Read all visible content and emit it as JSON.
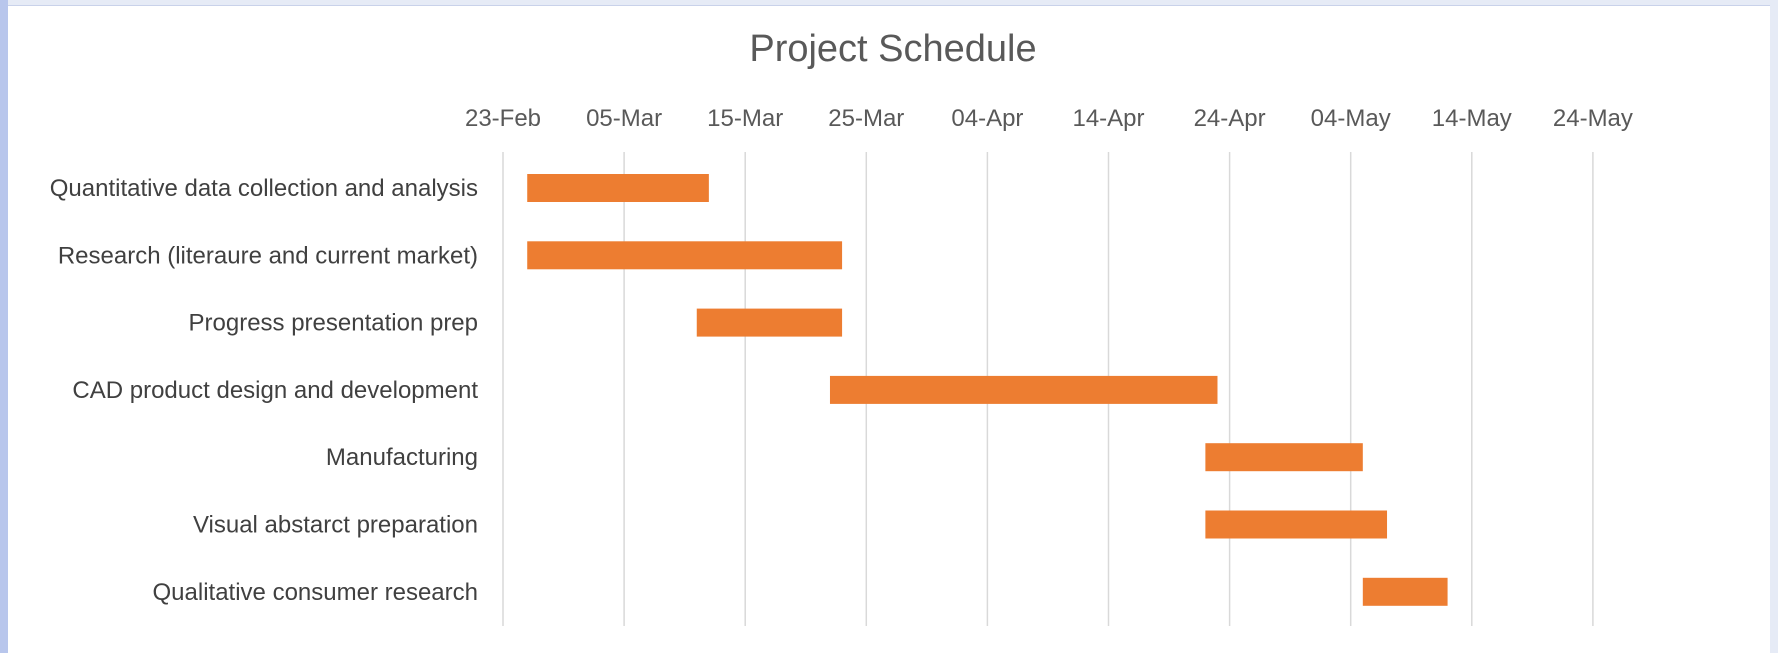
{
  "chart_data": {
    "type": "bar",
    "subtype": "gantt",
    "title": "Project Schedule",
    "bar_color": "#ED7D31",
    "grid": true,
    "x_axis_position": "top",
    "xlim": [
      "2020-02-23",
      "2020-06-02"
    ],
    "x_ticks": [
      "23-Feb",
      "05-Mar",
      "15-Mar",
      "25-Mar",
      "04-Apr",
      "14-Apr",
      "24-Apr",
      "04-May",
      "14-May",
      "24-May"
    ],
    "tasks": [
      {
        "name": "Quantitative data collection and analysis",
        "start": "2020-02-25",
        "end": "2020-03-11"
      },
      {
        "name": "Research (literaure and current market)",
        "start": "2020-02-25",
        "end": "2020-03-22"
      },
      {
        "name": "Progress presentation prep",
        "start": "2020-03-10",
        "end": "2020-03-22"
      },
      {
        "name": "CAD product design and development",
        "start": "2020-03-21",
        "end": "2020-04-22"
      },
      {
        "name": "Manufacturing",
        "start": "2020-04-21",
        "end": "2020-05-04"
      },
      {
        "name": "Visual abstarct preparation",
        "start": "2020-04-21",
        "end": "2020-05-06"
      },
      {
        "name": "Qualitative consumer research",
        "start": "2020-05-04",
        "end": "2020-05-11"
      }
    ]
  }
}
